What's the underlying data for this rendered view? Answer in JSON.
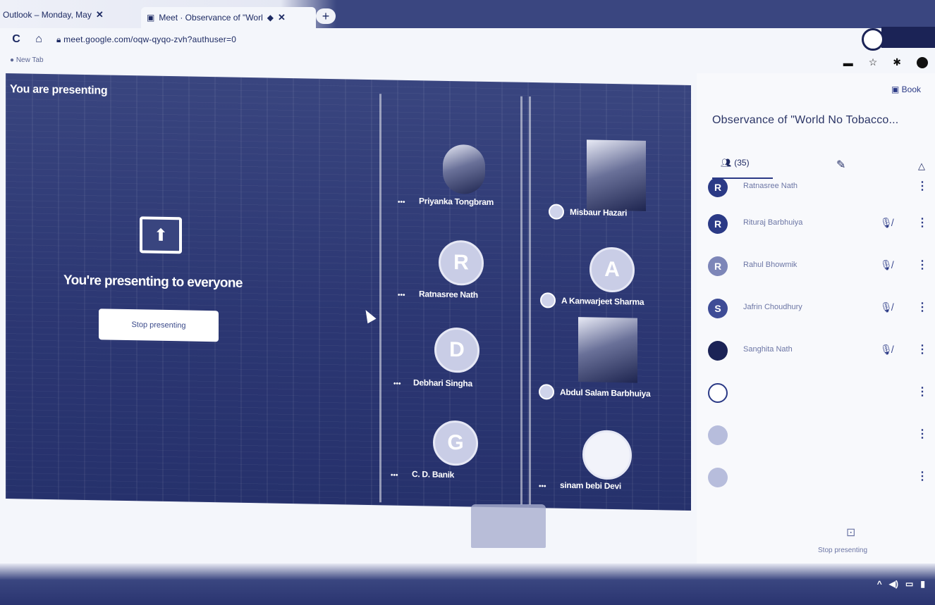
{
  "browser": {
    "tabs": [
      {
        "title": "Outlook – Monday, May",
        "active": false
      },
      {
        "title": "Meet · Observance of \"Worl",
        "active": true
      }
    ],
    "new_tab": "+",
    "url": "meet.google.com/oqw-qyqo-zvh?authuser=0",
    "bookmark": "New Tab"
  },
  "stage": {
    "presenting_label": "You are presenting",
    "presenting_message": "You're presenting to everyone",
    "stop_button": "Stop presenting",
    "tiles": [
      {
        "name": "Priyanka Tongbram",
        "type": "photo"
      },
      {
        "name": "Misbaur Hazari",
        "type": "photo"
      },
      {
        "name": "Ratnasree Nath",
        "type": "letter",
        "letter": "R"
      },
      {
        "name": "A Kanwarjeet Sharma",
        "type": "letter",
        "letter": "A"
      },
      {
        "name": "Debhari Singha",
        "type": "letter",
        "letter": "D"
      },
      {
        "name": "Abdul Salam Barbhuiya",
        "type": "photo"
      },
      {
        "name": "C. D. Banik",
        "type": "letter",
        "letter": "G"
      },
      {
        "name": "sinam bebi Devi",
        "type": "photo"
      }
    ]
  },
  "panel": {
    "meeting_title": "Observance of \"World No Tobacco...",
    "people_count": "(35)",
    "participants": [
      {
        "initial": "R",
        "name": "Ratnasree Nath"
      },
      {
        "initial": "R",
        "name": "Rituraj Barbhuiya"
      },
      {
        "initial": "R",
        "name": "Rahul Bhowmik"
      },
      {
        "initial": "S",
        "name": "Jafrin Choudhury"
      },
      {
        "initial": "",
        "name": "Sanghita Nath"
      },
      {
        "initial": "",
        "name": ""
      },
      {
        "initial": "",
        "name": ""
      },
      {
        "initial": "",
        "name": ""
      }
    ],
    "present_control_label": "Stop presenting"
  },
  "colors": {
    "stage": "#2c3773",
    "panel": "#f8f9fc",
    "accent": "#2b3a86"
  }
}
